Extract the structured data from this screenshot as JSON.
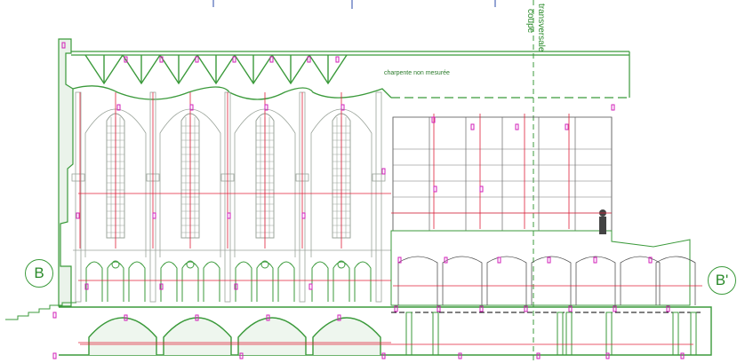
{
  "annotations": {
    "roof_note": "charpente non mesurée",
    "section_title_line1": "coupe",
    "section_title_line2": "transversale",
    "grid_marker_left": "B",
    "grid_marker_right": "B'"
  },
  "colors": {
    "outline": "#3b9a3b",
    "dimension": "#e0203a",
    "height_tag": "#d21fb8",
    "detail": "#9aa39a",
    "text": "#2a7a2a"
  }
}
